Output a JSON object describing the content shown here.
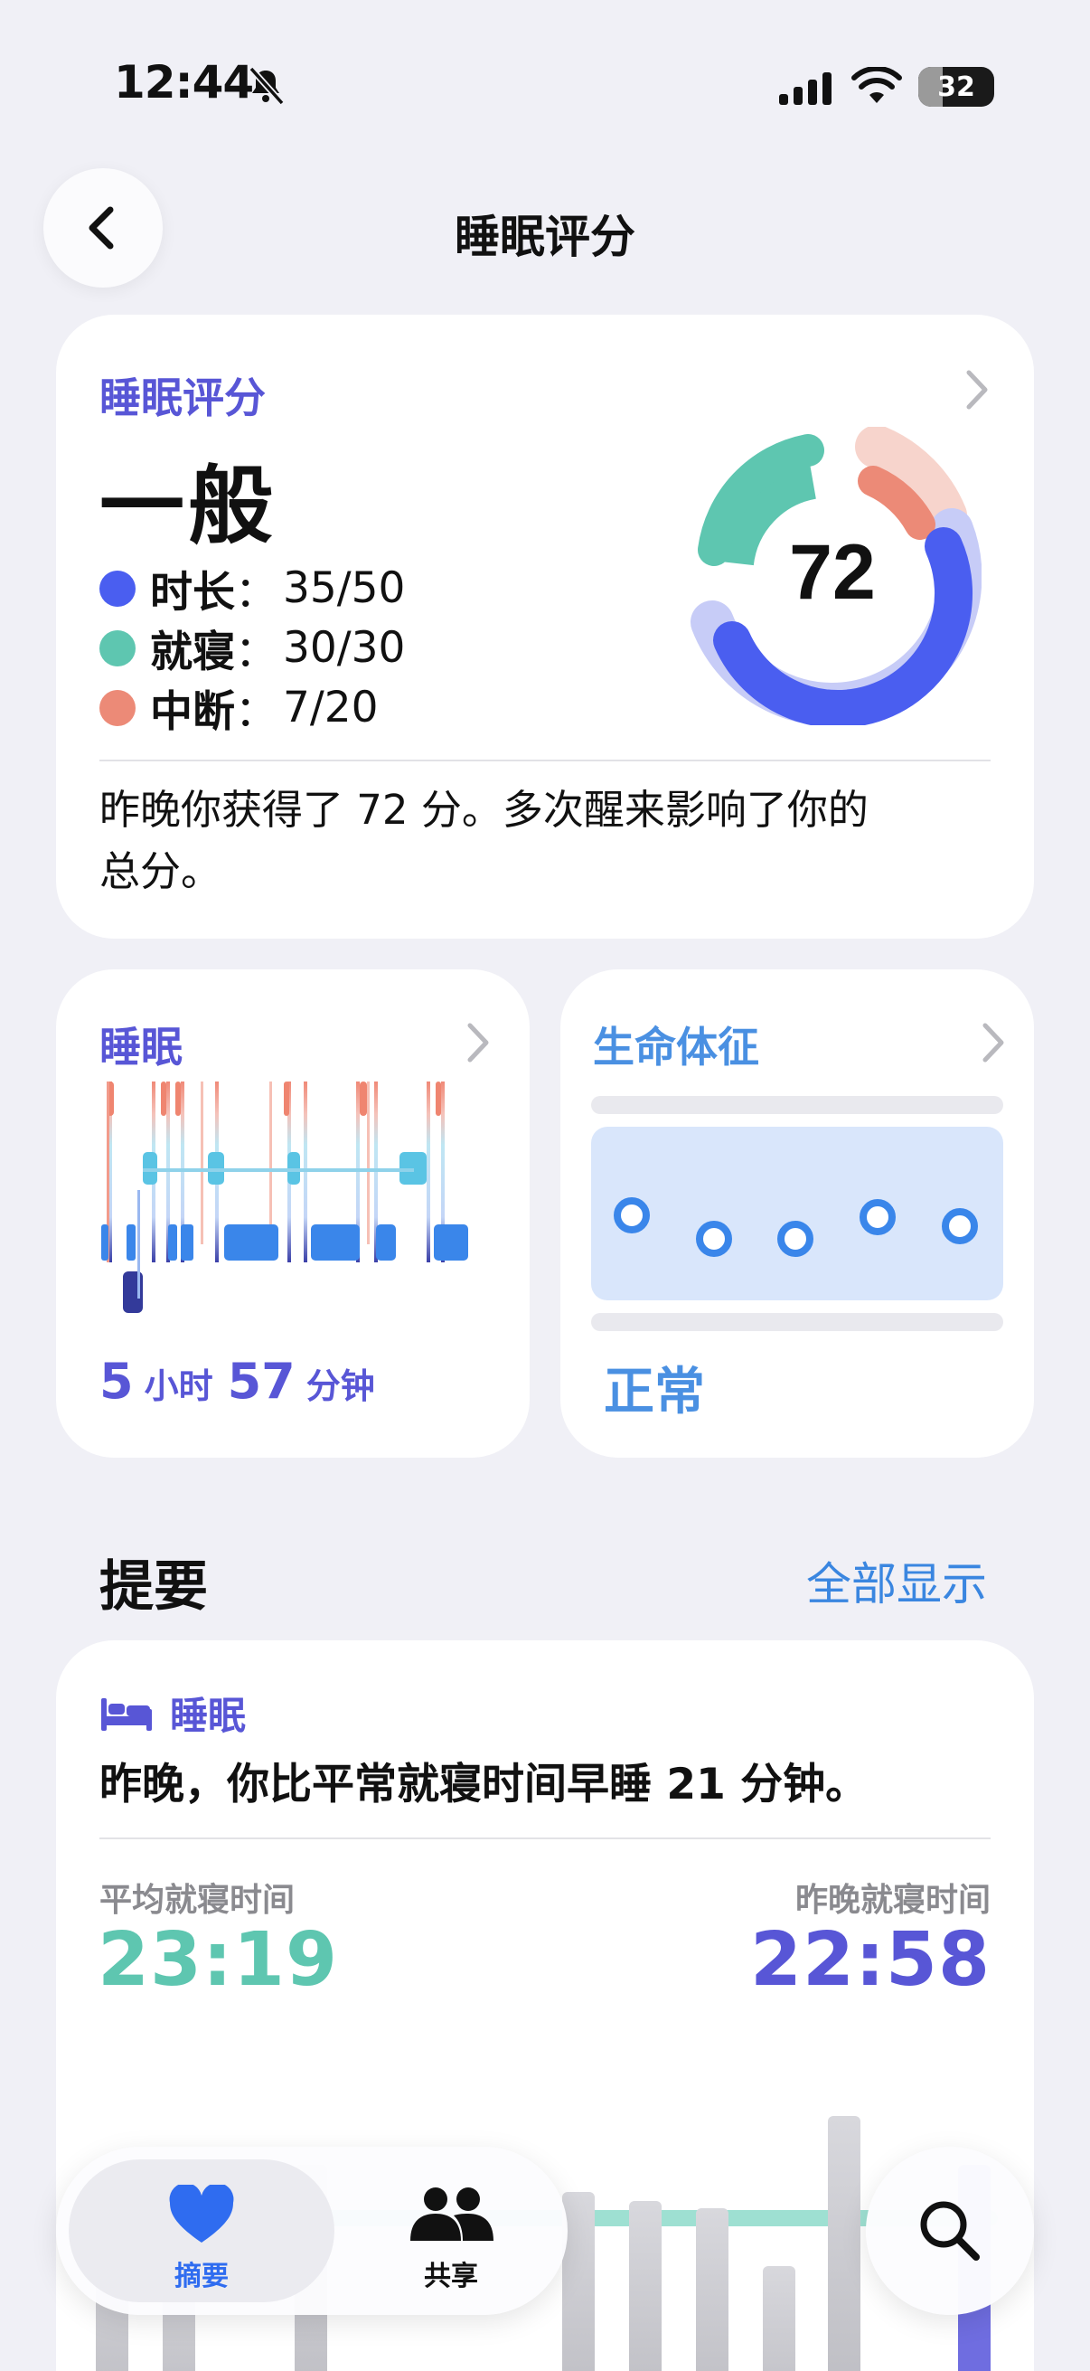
{
  "status_bar": {
    "time": "12:44",
    "battery": "32",
    "battery_level": 0.32
  },
  "nav": {
    "title": "睡眠评分"
  },
  "score_card": {
    "label": "睡眠评分",
    "rating": "一般",
    "score": "72",
    "metrics": [
      {
        "name": "时长",
        "sep": "：",
        "value": "35/50",
        "color": "#4a5ef0"
      },
      {
        "name": "就寝",
        "sep": "：",
        "value": "30/30",
        "color": "#5ec6b0"
      },
      {
        "name": "中断",
        "sep": "：",
        "value": "7/20",
        "color": "#ec8a77"
      }
    ],
    "summary": "昨晚你获得了 72 分。多次醒来影响了你的总分。"
  },
  "sleep_card": {
    "label": "睡眠",
    "hours": "5",
    "hours_unit": "小时",
    "minutes": "57",
    "minutes_unit": "分钟"
  },
  "vitals_card": {
    "label": "生命体征",
    "status": "正常"
  },
  "highlights": {
    "title": "提要",
    "show_all": "全部显示",
    "card": {
      "tag": "睡眠",
      "text": "昨晚，你比平常就寝时间早睡 21 分钟。",
      "avg_label": "平均就寝时间",
      "avg_value": "23:19",
      "last_label": "昨晚就寝时间",
      "last_value": "22:58"
    }
  },
  "tabbar": {
    "summary": "摘要",
    "sharing": "共享"
  },
  "colors": {
    "accent": "#5856d6",
    "teal": "#5ec6b0",
    "blue": "#4a5ef0",
    "coral": "#ec8a77",
    "link": "#3a86e0"
  }
}
